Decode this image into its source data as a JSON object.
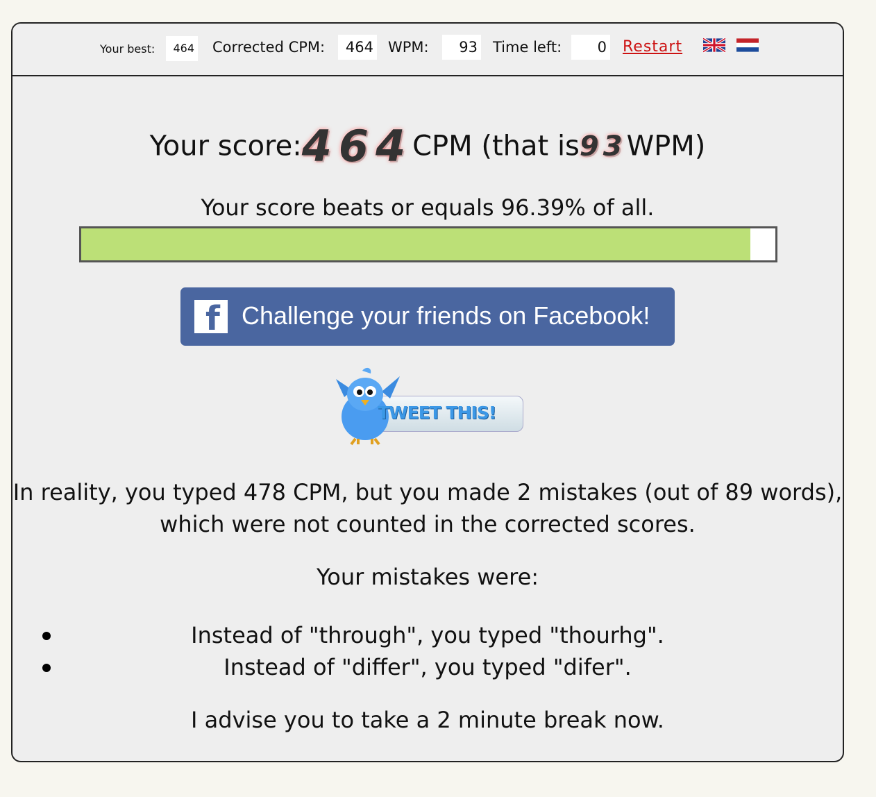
{
  "stats": {
    "best_label": "Your best:",
    "best_value": "464",
    "cpm_label": "Corrected CPM:",
    "cpm_value": "464",
    "wpm_label": "WPM:",
    "wpm_value": "93",
    "time_label": "Time left:",
    "time_value": "0",
    "restart_label": "Restart"
  },
  "languages": [
    "english-flag-icon",
    "dutch-flag-icon"
  ],
  "result": {
    "prefix": "Your score:",
    "cpm": "464",
    "middle": "CPM (that is",
    "wpm": "93",
    "suffix": "WPM)",
    "percentile_text": "Your score beats or equals 96.39% of all.",
    "percentile": 96.39
  },
  "social": {
    "facebook_label": "Challenge your friends on Facebook!",
    "facebook_icon": "facebook-icon",
    "tweet_label": "TWEET THIS!",
    "tweet_icon": "bird-icon"
  },
  "details": {
    "reality_line1": "In reality, you typed 478 CPM, but you made 2 mistakes (out of 89 words),",
    "reality_line2": "which were not counted in the corrected scores.",
    "mistakes_title": "Your mistakes were:",
    "mistakes": [
      "Instead of \"through\", you typed \"thourhg\".",
      "Instead of \"differ\", you typed \"difer\"."
    ],
    "advice": "I advise you to take a 2 minute break now."
  },
  "colors": {
    "progress_fill": "#bce077",
    "facebook_blue": "#4a66a0",
    "restart_red": "#cc1111"
  }
}
